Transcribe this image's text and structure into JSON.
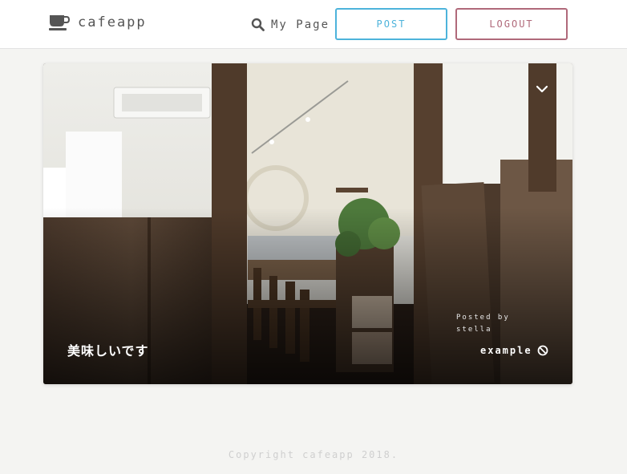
{
  "header": {
    "brand_name": "cafeapp",
    "brand_icon": "coffee-cup-icon",
    "search_icon": "search-icon",
    "mypage_label": "My Page",
    "post_label": "POST",
    "logout_label": "LOGOUT"
  },
  "colors": {
    "post_accent": "#4db3db",
    "logout_accent": "#b0697a"
  },
  "card": {
    "title": "美味しいです",
    "posted_by_label": "Posted by",
    "posted_by_name": "stella",
    "author_link": "example",
    "author_icon": "block-icon",
    "menu_icon": "chevron-down-icon"
  },
  "footer": {
    "copyright": "Copyright cafeapp 2018."
  }
}
